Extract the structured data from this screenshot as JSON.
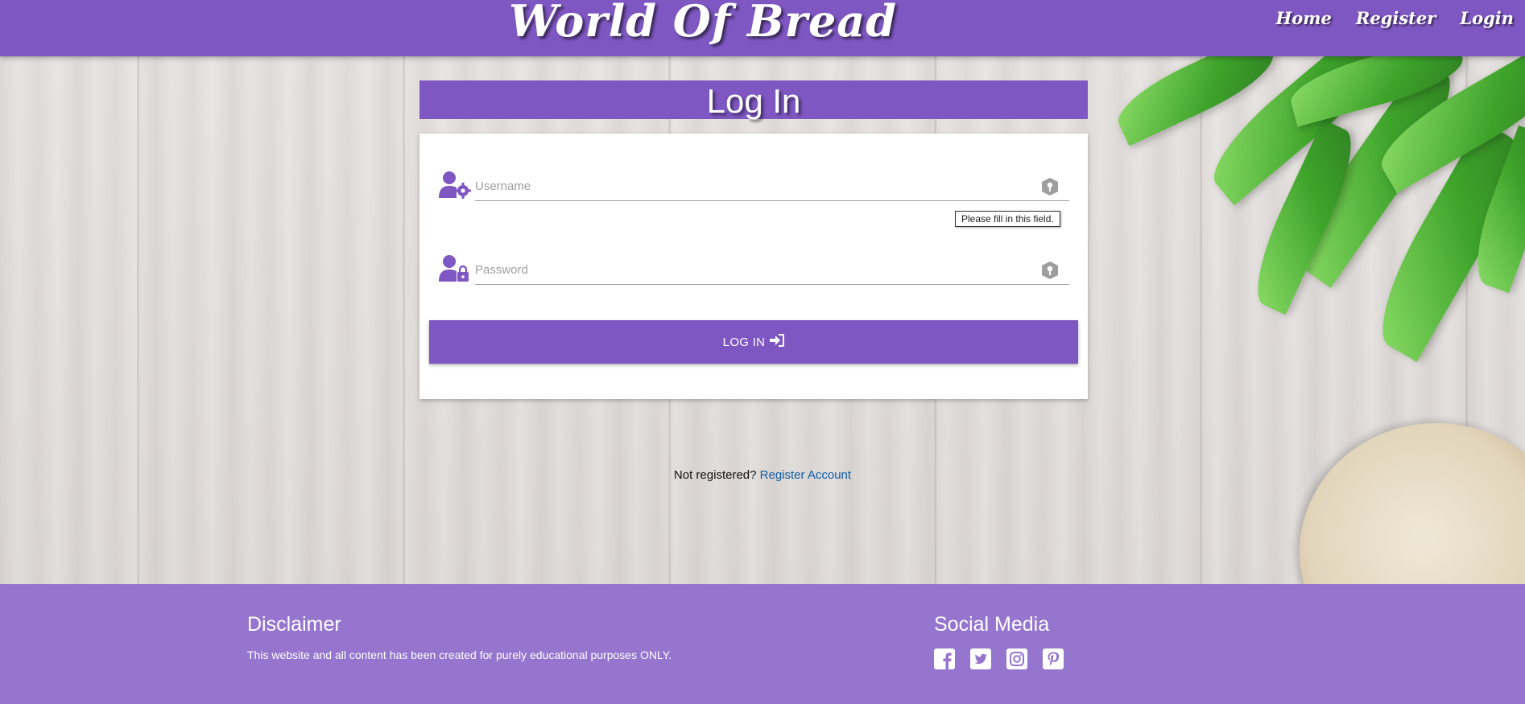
{
  "header": {
    "brand": "World Of Bread",
    "nav": [
      {
        "label": "Home"
      },
      {
        "label": "Register"
      },
      {
        "label": "Login"
      }
    ]
  },
  "login": {
    "title": "Log In",
    "username_placeholder": "Username",
    "password_placeholder": "Password",
    "validation_tooltip": "Please fill in this field.",
    "button_label": "LOG IN"
  },
  "register_prompt": {
    "text": "Not registered?",
    "link": "Register Account"
  },
  "footer": {
    "disclaimer_title": "Disclaimer",
    "disclaimer_text": "This website and all content has been created for purely educational purposes ONLY.",
    "social_title": "Social Media",
    "social_icons": [
      "facebook-icon",
      "twitter-icon",
      "instagram-icon",
      "pinterest-icon"
    ]
  },
  "colors": {
    "primary": "#7e57c2",
    "footer": "#9575cd",
    "link": "#0d5ca6"
  }
}
